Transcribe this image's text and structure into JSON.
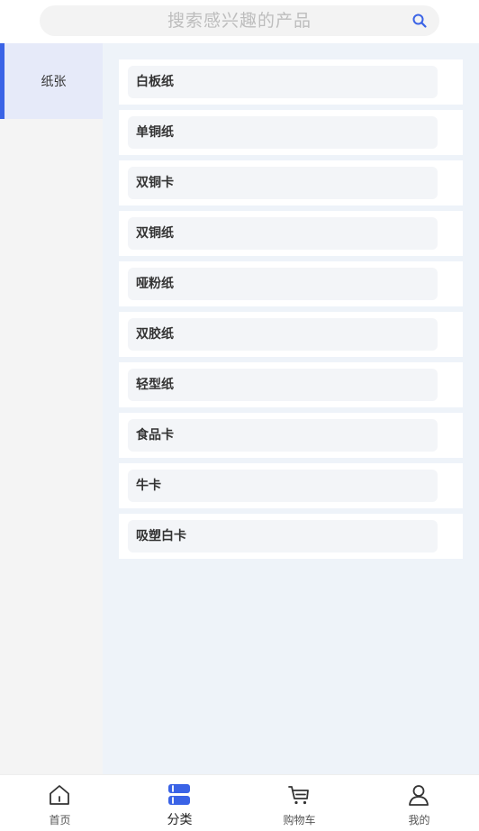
{
  "search": {
    "placeholder": "搜索感兴趣的产品",
    "icon": "search-icon"
  },
  "sidebar": {
    "items": [
      {
        "label": "纸张",
        "selected": true
      }
    ]
  },
  "products": [
    {
      "label": "白板纸"
    },
    {
      "label": "单铜纸"
    },
    {
      "label": "双铜卡"
    },
    {
      "label": "双铜纸"
    },
    {
      "label": "哑粉纸"
    },
    {
      "label": "双胶纸"
    },
    {
      "label": "轻型纸"
    },
    {
      "label": "食品卡"
    },
    {
      "label": "牛卡"
    },
    {
      "label": "吸塑白卡"
    }
  ],
  "tabbar": {
    "tabs": [
      {
        "label": "首页",
        "icon": "home-icon"
      },
      {
        "label": "分类",
        "icon": "category-icon",
        "active": true
      },
      {
        "label": "购物车",
        "icon": "cart-icon"
      },
      {
        "label": "我的",
        "icon": "user-icon"
      }
    ]
  },
  "colors": {
    "accent": "#3a63e6",
    "sidebar_selected_bg": "#e6eaf9",
    "content_bg": "#eef3f9"
  }
}
